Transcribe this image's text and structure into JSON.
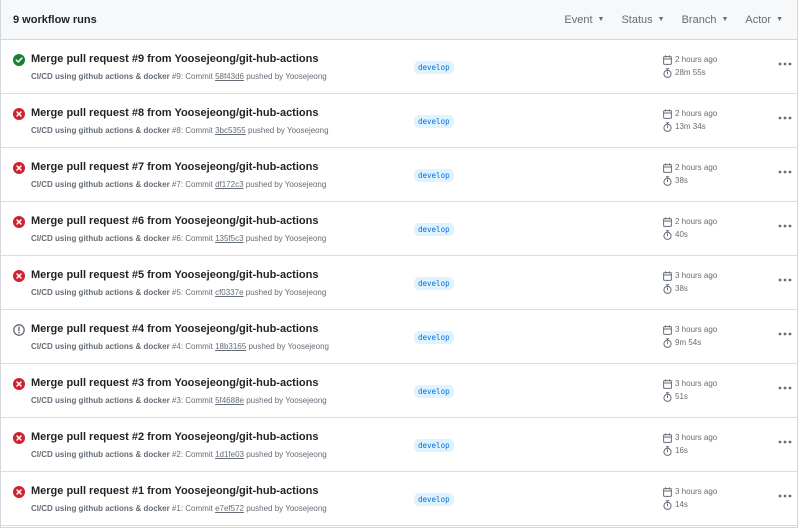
{
  "header": {
    "title": "9 workflow runs",
    "filters": [
      "Event",
      "Status",
      "Branch",
      "Actor"
    ]
  },
  "colors": {
    "success": "#1a7f37",
    "failure": "#cf222e",
    "cancelled": "#656d76",
    "branch_bg": "#ddf4ff",
    "branch_fg": "#0969da"
  },
  "runs": [
    {
      "status": "success",
      "status_icon": "check-circle-icon",
      "title": "Merge pull request #9 from Yoosejeong/git-hub-actions",
      "workflow": "CI/CD using github actions & docker",
      "run_number": "#9: Commit",
      "commit": "58f43d6",
      "pushed_by": "pushed by Yoosejeong",
      "branch": "develop",
      "started": "2 hours ago",
      "duration": "28m 55s"
    },
    {
      "status": "failure",
      "status_icon": "x-circle-icon",
      "title": "Merge pull request #8 from Yoosejeong/git-hub-actions",
      "workflow": "CI/CD using github actions & docker",
      "run_number": "#8: Commit",
      "commit": "3bc5355",
      "pushed_by": "pushed by Yoosejeong",
      "branch": "develop",
      "started": "2 hours ago",
      "duration": "13m 34s"
    },
    {
      "status": "failure",
      "status_icon": "x-circle-icon",
      "title": "Merge pull request #7 from Yoosejeong/git-hub-actions",
      "workflow": "CI/CD using github actions & docker",
      "run_number": "#7: Commit",
      "commit": "df172c3",
      "pushed_by": "pushed by Yoosejeong",
      "branch": "develop",
      "started": "2 hours ago",
      "duration": "38s"
    },
    {
      "status": "failure",
      "status_icon": "x-circle-icon",
      "title": "Merge pull request #6 from Yoosejeong/git-hub-actions",
      "workflow": "CI/CD using github actions & docker",
      "run_number": "#6: Commit",
      "commit": "135f5c3",
      "pushed_by": "pushed by Yoosejeong",
      "branch": "develop",
      "started": "2 hours ago",
      "duration": "40s"
    },
    {
      "status": "failure",
      "status_icon": "x-circle-icon",
      "title": "Merge pull request #5 from Yoosejeong/git-hub-actions",
      "workflow": "CI/CD using github actions & docker",
      "run_number": "#5: Commit",
      "commit": "cf0337e",
      "pushed_by": "pushed by Yoosejeong",
      "branch": "develop",
      "started": "3 hours ago",
      "duration": "38s"
    },
    {
      "status": "cancelled",
      "status_icon": "alert-circle-icon",
      "title": "Merge pull request #4 from Yoosejeong/git-hub-actions",
      "workflow": "CI/CD using github actions & docker",
      "run_number": "#4: Commit",
      "commit": "18b3165",
      "pushed_by": "pushed by Yoosejeong",
      "branch": "develop",
      "started": "3 hours ago",
      "duration": "9m 54s"
    },
    {
      "status": "failure",
      "status_icon": "x-circle-icon",
      "title": "Merge pull request #3 from Yoosejeong/git-hub-actions",
      "workflow": "CI/CD using github actions & docker",
      "run_number": "#3: Commit",
      "commit": "5f4688e",
      "pushed_by": "pushed by Yoosejeong",
      "branch": "develop",
      "started": "3 hours ago",
      "duration": "51s"
    },
    {
      "status": "failure",
      "status_icon": "x-circle-icon",
      "title": "Merge pull request #2 from Yoosejeong/git-hub-actions",
      "workflow": "CI/CD using github actions & docker",
      "run_number": "#2: Commit",
      "commit": "1d1fe03",
      "pushed_by": "pushed by Yoosejeong",
      "branch": "develop",
      "started": "3 hours ago",
      "duration": "16s"
    },
    {
      "status": "failure",
      "status_icon": "x-circle-icon",
      "title": "Merge pull request #1 from Yoosejeong/git-hub-actions",
      "workflow": "CI/CD using github actions & docker",
      "run_number": "#1: Commit",
      "commit": "e7ef572",
      "pushed_by": "pushed by Yoosejeong",
      "branch": "develop",
      "started": "3 hours ago",
      "duration": "14s"
    }
  ]
}
